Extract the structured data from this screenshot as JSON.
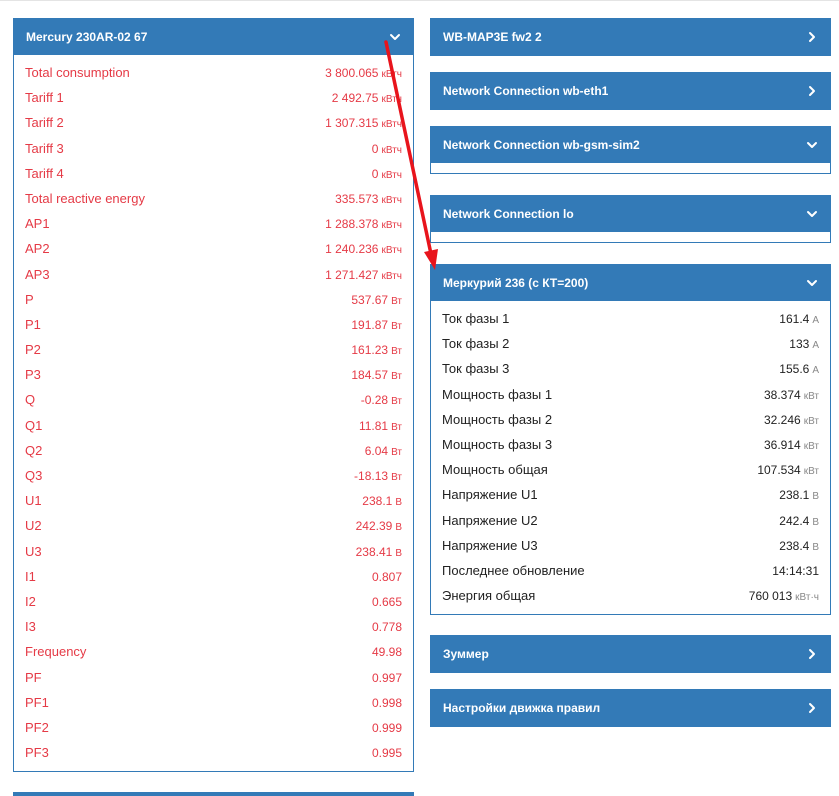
{
  "mercury": {
    "title": "Mercury 230AR-02 67",
    "rows": [
      {
        "label": "Total consumption",
        "value": "3 800.065",
        "unit": "кВтч"
      },
      {
        "label": "Tariff 1",
        "value": "2 492.75",
        "unit": "кВтч"
      },
      {
        "label": "Tariff 2",
        "value": "1 307.315",
        "unit": "кВтч"
      },
      {
        "label": "Tariff 3",
        "value": "0",
        "unit": "кВтч"
      },
      {
        "label": "Tariff 4",
        "value": "0",
        "unit": "кВтч"
      },
      {
        "label": "Total reactive energy",
        "value": "335.573",
        "unit": "кВтч"
      },
      {
        "label": "AP1",
        "value": "1 288.378",
        "unit": "кВтч"
      },
      {
        "label": "AP2",
        "value": "1 240.236",
        "unit": "кВтч"
      },
      {
        "label": "AP3",
        "value": "1 271.427",
        "unit": "кВтч"
      },
      {
        "label": "P",
        "value": "537.67",
        "unit": "Вт"
      },
      {
        "label": "P1",
        "value": "191.87",
        "unit": "Вт"
      },
      {
        "label": "P2",
        "value": "161.23",
        "unit": "Вт"
      },
      {
        "label": "P3",
        "value": "184.57",
        "unit": "Вт"
      },
      {
        "label": "Q",
        "value": "-0.28",
        "unit": "Вт"
      },
      {
        "label": "Q1",
        "value": "11.81",
        "unit": "Вт"
      },
      {
        "label": "Q2",
        "value": "6.04",
        "unit": "Вт"
      },
      {
        "label": "Q3",
        "value": "-18.13",
        "unit": "Вт"
      },
      {
        "label": "U1",
        "value": "238.1",
        "unit": "В"
      },
      {
        "label": "U2",
        "value": "242.39",
        "unit": "В"
      },
      {
        "label": "U3",
        "value": "238.41",
        "unit": "В"
      },
      {
        "label": "I1",
        "value": "0.807",
        "unit": ""
      },
      {
        "label": "I2",
        "value": "0.665",
        "unit": ""
      },
      {
        "label": "I3",
        "value": "0.778",
        "unit": ""
      },
      {
        "label": "Frequency",
        "value": "49.98",
        "unit": ""
      },
      {
        "label": "PF",
        "value": "0.997",
        "unit": ""
      },
      {
        "label": "PF1",
        "value": "0.998",
        "unit": ""
      },
      {
        "label": "PF2",
        "value": "0.999",
        "unit": ""
      },
      {
        "label": "PF3",
        "value": "0.995",
        "unit": ""
      }
    ]
  },
  "right_panels": {
    "wbmap": {
      "title": "WB-MAP3E fw2 2"
    },
    "eth1": {
      "title": "Network Connection wb-eth1"
    },
    "gsm": {
      "title": "Network Connection wb-gsm-sim2"
    },
    "lo": {
      "title": "Network Connection lo"
    },
    "merc236": {
      "title": "Меркурий 236 (с КТ=200)",
      "rows": [
        {
          "label": "Ток фазы 1",
          "value": "161.4",
          "unit": "A"
        },
        {
          "label": "Ток фазы 2",
          "value": "133",
          "unit": "A"
        },
        {
          "label": "Ток фазы 3",
          "value": "155.6",
          "unit": "A"
        },
        {
          "label": "Мощность фазы 1",
          "value": "38.374",
          "unit": "кВт"
        },
        {
          "label": "Мощность фазы 2",
          "value": "32.246",
          "unit": "кВт"
        },
        {
          "label": "Мощность фазы 3",
          "value": "36.914",
          "unit": "кВт"
        },
        {
          "label": "Мощность общая",
          "value": "107.534",
          "unit": "кВт"
        },
        {
          "label": "Напряжение U1",
          "value": "238.1",
          "unit": "В"
        },
        {
          "label": "Напряжение U2",
          "value": "242.4",
          "unit": "В"
        },
        {
          "label": "Напряжение U3",
          "value": "238.4",
          "unit": "В"
        },
        {
          "label": "Последнее обновление",
          "value": "14:14:31",
          "unit": ""
        },
        {
          "label": "Энергия общая",
          "value": "760 013",
          "unit": "кВт·ч"
        }
      ]
    },
    "buzzer": {
      "title": "Зуммер"
    },
    "rules": {
      "title": "Настройки движка правил"
    }
  },
  "colors": {
    "panel_header": "#337ab7",
    "alert_text": "#e53a46",
    "arrow": "#e8141c"
  },
  "icons": {
    "expanded": "chevron-down-icon",
    "collapsed": "chevron-right-icon"
  }
}
